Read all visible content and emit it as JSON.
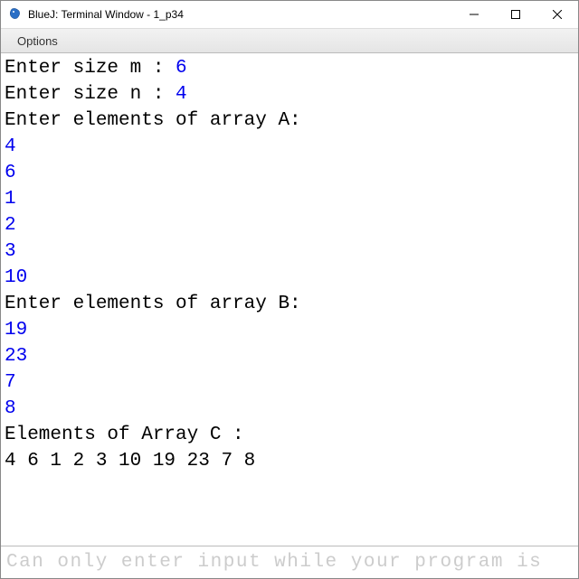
{
  "window": {
    "title": "BlueJ: Terminal Window - 1_p34"
  },
  "menu": {
    "options": "Options"
  },
  "terminal": {
    "lines": [
      {
        "prompt": "Enter size m : ",
        "input": "6"
      },
      {
        "prompt": "Enter size n : ",
        "input": "4"
      },
      {
        "prompt": "Enter elements of array A:",
        "input": ""
      },
      {
        "prompt": "",
        "input": "4"
      },
      {
        "prompt": "",
        "input": "6"
      },
      {
        "prompt": "",
        "input": "1"
      },
      {
        "prompt": "",
        "input": "2"
      },
      {
        "prompt": "",
        "input": "3"
      },
      {
        "prompt": "",
        "input": "10"
      },
      {
        "prompt": "Enter elements of array B:",
        "input": ""
      },
      {
        "prompt": "",
        "input": "19"
      },
      {
        "prompt": "",
        "input": "23"
      },
      {
        "prompt": "",
        "input": "7"
      },
      {
        "prompt": "",
        "input": "8"
      },
      {
        "prompt": "Elements of Array C :",
        "input": ""
      },
      {
        "prompt": "4 6 1 2 3 10 19 23 7 8",
        "input": ""
      }
    ]
  },
  "footer": {
    "hint": "Can only enter input while your program is "
  }
}
